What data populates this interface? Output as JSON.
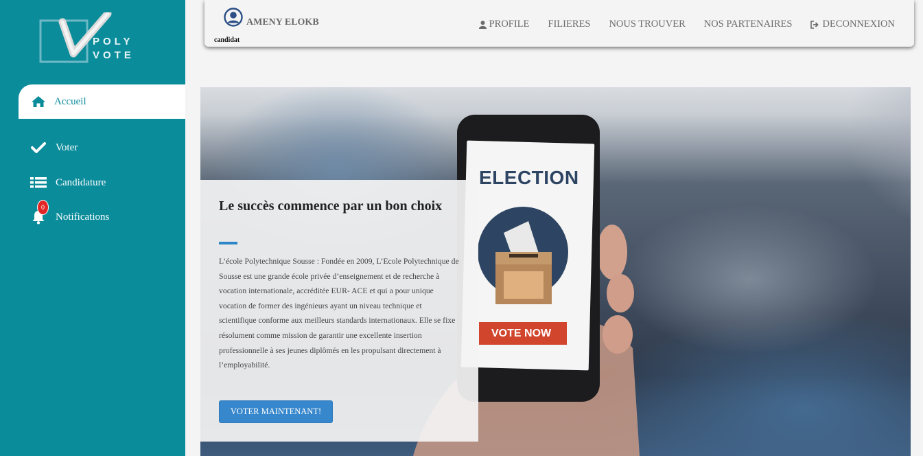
{
  "logo": {
    "line1": "POLY",
    "line2": "VOTE"
  },
  "sidebar": {
    "items": [
      {
        "label": "Accueil",
        "icon": "home-icon",
        "active": true
      },
      {
        "label": "Voter",
        "icon": "check-icon"
      },
      {
        "label": "Candidature",
        "icon": "list-icon"
      },
      {
        "label": "Notifications",
        "icon": "bell-icon",
        "badge": "0"
      }
    ]
  },
  "header": {
    "user_name": "AMENY ELOKB",
    "user_role": "candidat",
    "menu": [
      {
        "label": "PROFILE",
        "icon": "user-icon"
      },
      {
        "label": "FILIERES"
      },
      {
        "label": "NOUS TROUVER"
      },
      {
        "label": "NOS PARTENAIRES"
      },
      {
        "label": "DECONNEXION",
        "icon": "sign-out-icon"
      }
    ]
  },
  "hero": {
    "title": "Le succès commence par un bon choix",
    "text": "L’école Polytechnique Sousse : Fondée en 2009, L’Ecole Polytechnique de Sousse est une grande école privée d’enseignement et de recherche à vocation internationale, accréditée EUR- ACE et qui a pour unique vocation de former des ingénieurs ayant un niveau technique et scientifique conforme aux meilleurs standards internationaux. Elle se fixe résolument comme mission de garantir une excellente insertion professionnelle à ses jeunes diplômés en les propulsant directement à l’employabilité.",
    "button": "VOTER MAINTENANT!",
    "phone_title": "ELECTION",
    "phone_button": "VOTE NOW"
  },
  "colors": {
    "sidebar": "#0b8c9b",
    "button": "#3687cc",
    "badge": "#e32525",
    "vote_now": "#d2452d"
  }
}
